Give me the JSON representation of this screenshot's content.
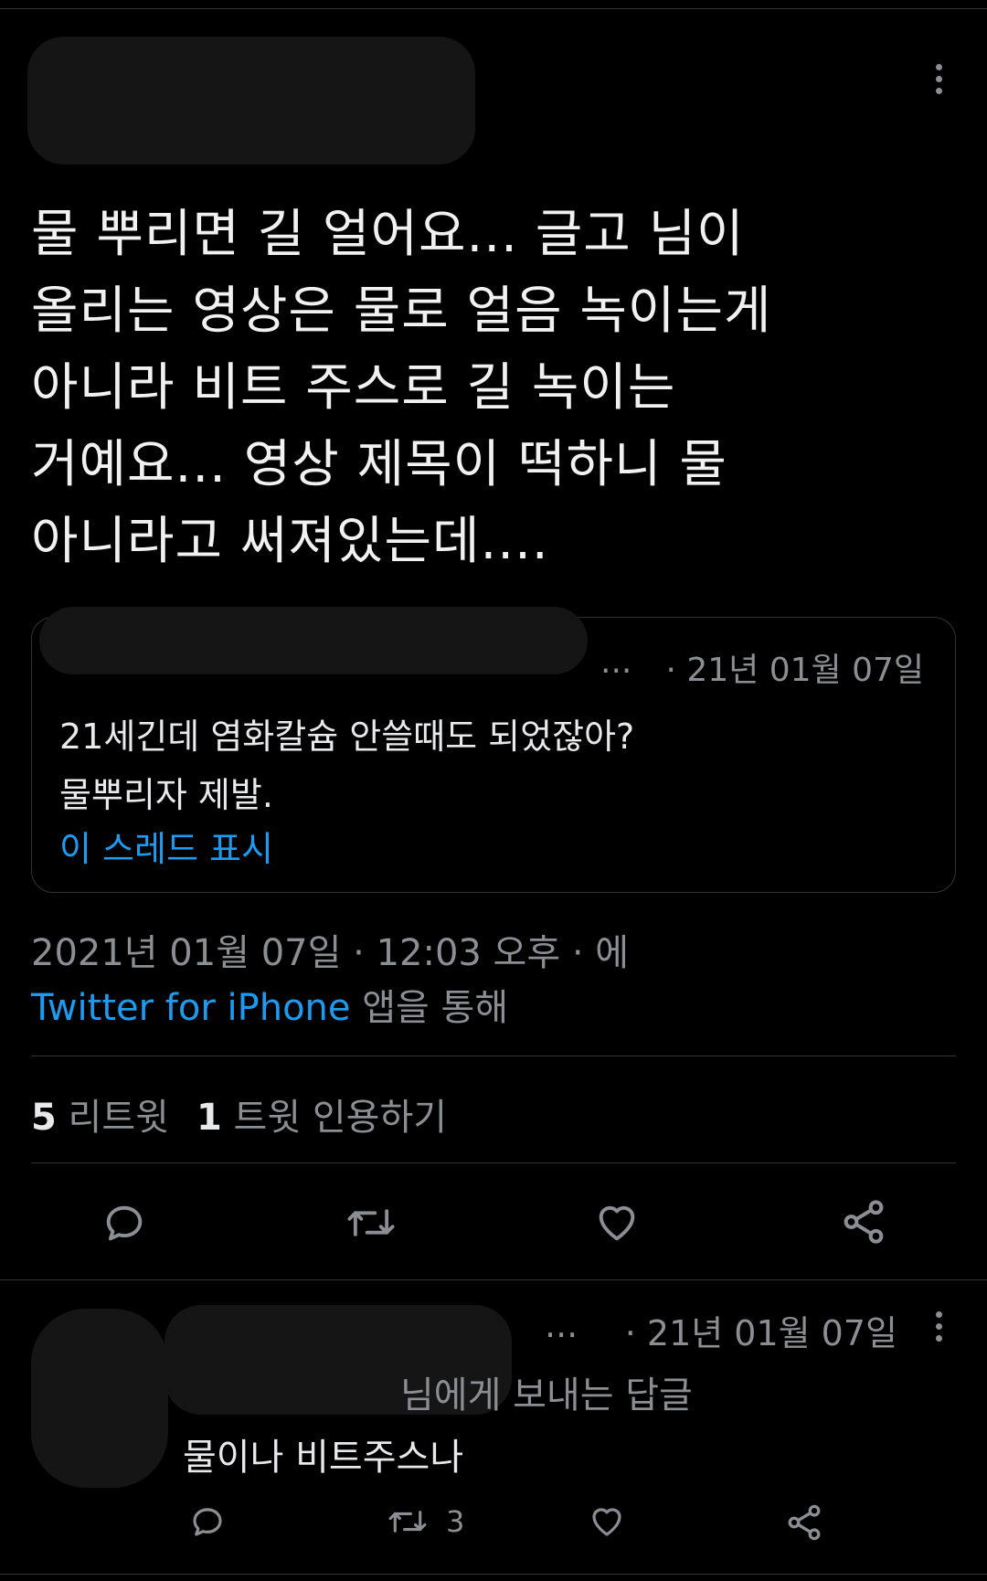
{
  "tweet": {
    "text_lines": [
      "물 뿌리면 길 얼어요... 글고 님이",
      "올리는 영상은 물로 얼음 녹이는게",
      "아니라 비트 주스로 길 녹이는",
      "거예요... 영상 제목이 떡하니 물",
      "아니라고 써져있는데...."
    ],
    "quote": {
      "truncation": "...",
      "date": "· 21년 01월 07일",
      "text_lines": [
        "21세긴데 염화칼슘 안쓸때도 되었잖아?",
        "물뿌리자 제발."
      ],
      "show_thread": "이 스레드 표시"
    },
    "timestamp": "2021년 01월 07일 · 12:03 오후 · 에",
    "source_app": "Twitter for iPhone",
    "source_suffix": " 앱을 통해",
    "stats": {
      "retweets_count": "5",
      "retweets_label": " 리트윗",
      "quotes_count": "1",
      "quotes_label": " 트윗 인용하기"
    },
    "actions": {
      "reply_icon": "reply-icon",
      "retweet_icon": "retweet-icon",
      "like_icon": "heart-icon",
      "share_icon": "share-icon"
    }
  },
  "reply": {
    "truncation": "...",
    "date": "· 21년 01월 07일",
    "replying_to": "님에게 보내는 답글",
    "text": "물이나 비트주스나",
    "retweet_count": "3"
  },
  "colors": {
    "background": "#000000",
    "text": "#e7e9ea",
    "secondary": "#8b8f94",
    "accent": "#1d9bf0",
    "divider": "#2f3336"
  }
}
